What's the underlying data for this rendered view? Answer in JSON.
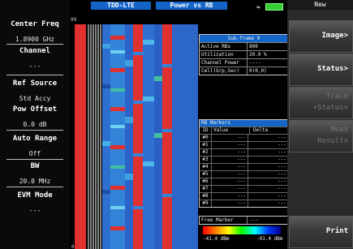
{
  "header": {
    "mode": "TDD-LTE",
    "measurement": "Power vs RB",
    "usb_icon": "usb-icon"
  },
  "left_panel": [
    {
      "label": "Center Freq",
      "value": "1.8900 GHz"
    },
    {
      "label": "Channel",
      "value": "---"
    },
    {
      "label": "Ref Source",
      "value": "Std Accy"
    },
    {
      "label": "Pow Offset",
      "value": "0.0 dB"
    },
    {
      "label": "Auto Range",
      "value": "Off"
    },
    {
      "label": "BW",
      "value": "20.0 MHz"
    },
    {
      "label": "EVM Mode",
      "value": "---"
    }
  ],
  "spectrogram": {
    "top_label": "99",
    "bottom_label": "0"
  },
  "subframe": {
    "title": "Sub-frame 0",
    "rows": [
      {
        "name": "Active RBs",
        "value": "800"
      },
      {
        "name": "Utilization",
        "value": "20.0 %"
      },
      {
        "name": "Channel Power",
        "value": "----"
      },
      {
        "name": "Cell(Grp,Sec)",
        "value": "0(0,0)"
      }
    ]
  },
  "rb_markers": {
    "title": "RB Markers",
    "headers": [
      "ID",
      "Value",
      "Delta"
    ],
    "rows": [
      {
        "id": "#0",
        "value": "---",
        "delta": "---"
      },
      {
        "id": "#1",
        "value": "---",
        "delta": "---"
      },
      {
        "id": "#2",
        "value": "---",
        "delta": "---"
      },
      {
        "id": "#3",
        "value": "---",
        "delta": "---"
      },
      {
        "id": "#4",
        "value": "---",
        "delta": "---"
      },
      {
        "id": "#5",
        "value": "---",
        "delta": "---"
      },
      {
        "id": "#6",
        "value": "---",
        "delta": "---"
      },
      {
        "id": "#7",
        "value": "---",
        "delta": "---"
      },
      {
        "id": "#8",
        "value": "---",
        "delta": "---"
      },
      {
        "id": "#9",
        "value": "---",
        "delta": "---"
      }
    ],
    "free_marker_label": "Free Marker",
    "free_marker_value": "---"
  },
  "colorbar": {
    "min_label": "-41.4 dBm",
    "max_label": "-91.4 dBm"
  },
  "softkeys": {
    "title": "New",
    "keys": [
      {
        "label": "Image>",
        "enabled": true
      },
      {
        "label": "Status>",
        "enabled": true
      },
      {
        "label_1": "Trace",
        "label_2": "+Status>",
        "enabled": false
      },
      {
        "label_1": "Meas",
        "label_2": "Result>",
        "enabled": false
      },
      {
        "label": "Print",
        "enabled": true
      }
    ]
  }
}
